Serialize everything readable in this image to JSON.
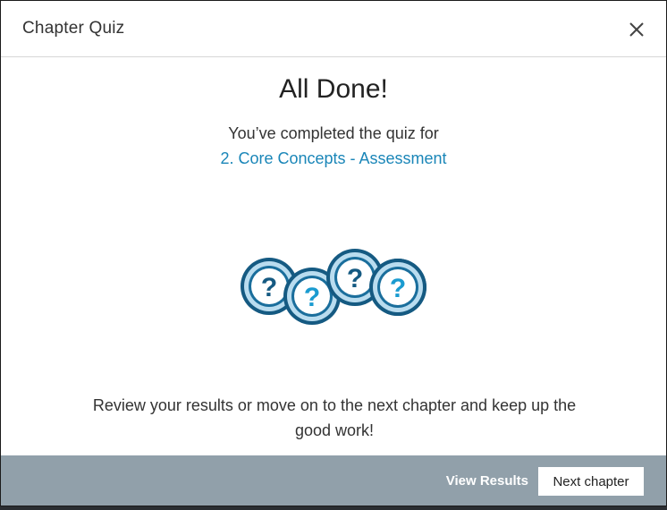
{
  "modal": {
    "title": "Chapter Quiz",
    "close_icon": "close-icon"
  },
  "body": {
    "heading": "All Done!",
    "completed_text": "You’ve completed the quiz for",
    "quiz_link": "2. Core Concepts - Assessment",
    "illustration_icon": "question-badges-icon",
    "badge_glyph": "?",
    "review_text": "Review your results or move on to the next chapter and keep up the good work!"
  },
  "footer": {
    "view_results_label": "View Results",
    "next_chapter_label": "Next chapter"
  },
  "colors": {
    "link": "#1a86b8",
    "footer_bg": "#91a0aa",
    "badge_dark": "#155a82",
    "badge_light": "#1a9bd0"
  }
}
